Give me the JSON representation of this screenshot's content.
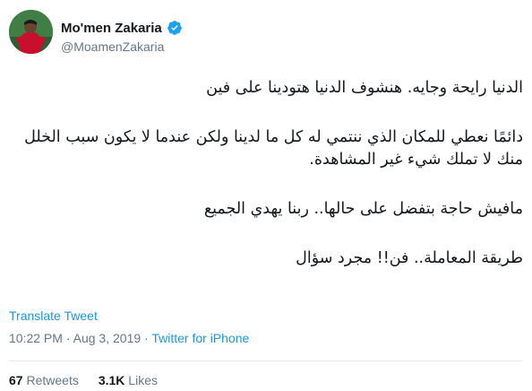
{
  "user": {
    "display_name": "Mo'men Zakaria",
    "handle": "@MoamenZakaria",
    "verified_icon": "verified-badge-icon"
  },
  "tweet": {
    "lines": [
      "الدنيا رايحة وجايه. هنشوف الدنيا هتودينا على فين",
      "دائمًا نعطي للمكان الذي ننتمي له كل ما لدينا ولكن عندما لا يكون سبب الخلل",
      "منك لا تملك شيء غير المشاهدة.",
      "مافيش حاجة بتفضل على حالها.. ربنا يهدي الجميع",
      "طريقة المعاملة.. فن!!  مجرد سؤال"
    ],
    "translate_label": "Translate Tweet",
    "time": "10:22 PM",
    "date": "Aug 3, 2019",
    "source": "Twitter for iPhone",
    "separator": "·"
  },
  "stats": {
    "retweets_count": "67",
    "retweets_label": "Retweets",
    "likes_count": "3.1K",
    "likes_label": "Likes"
  },
  "colors": {
    "link": "#1b95e0",
    "muted": "#657786",
    "text": "#14171a"
  }
}
